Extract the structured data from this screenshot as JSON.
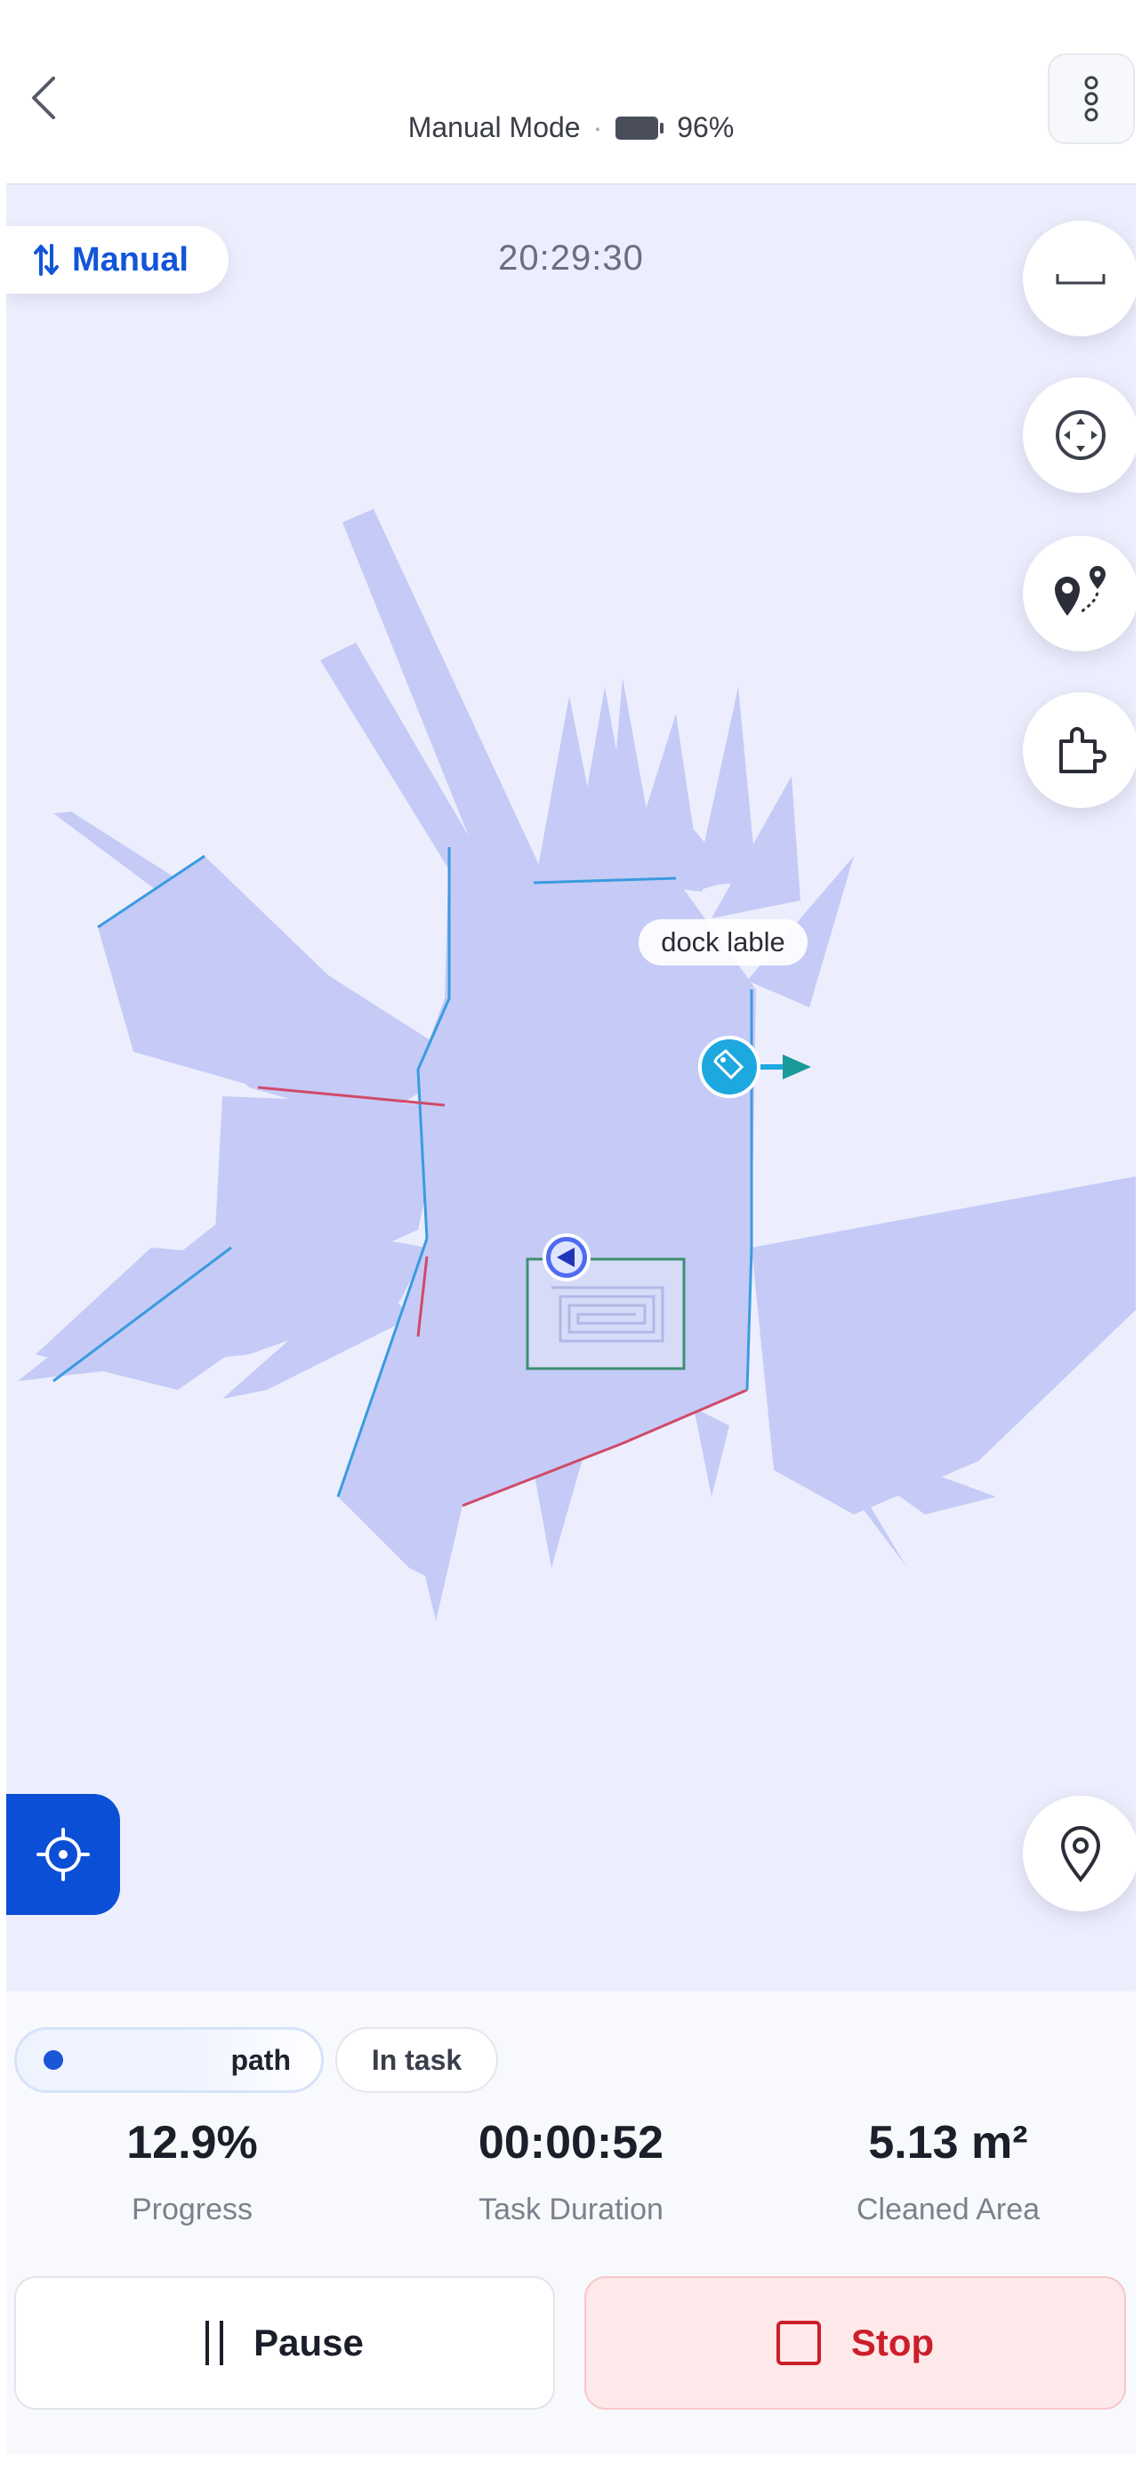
{
  "header": {
    "mode_text": "Manual Mode",
    "separator": "·",
    "battery": "96%"
  },
  "map": {
    "mode_label": "Manual",
    "time": "20:29:30",
    "dock_label": "dock lable"
  },
  "tabs": {
    "path_label": "path",
    "in_task_label": "In task"
  },
  "stats": [
    {
      "value": "12.9%",
      "label": "Progress"
    },
    {
      "value": "00:00:52",
      "label": "Task Duration"
    },
    {
      "value": "5.13 m²",
      "label": "Cleaned Area"
    }
  ],
  "actions": {
    "pause_label": "Pause",
    "stop_label": "Stop"
  },
  "colors": {
    "accent": "#0b4fd6",
    "map_background": "#edeefd",
    "explored_area": "#c5cbf6",
    "stop": "#cc1f2b",
    "dock_marker": "#1ea8e0"
  }
}
